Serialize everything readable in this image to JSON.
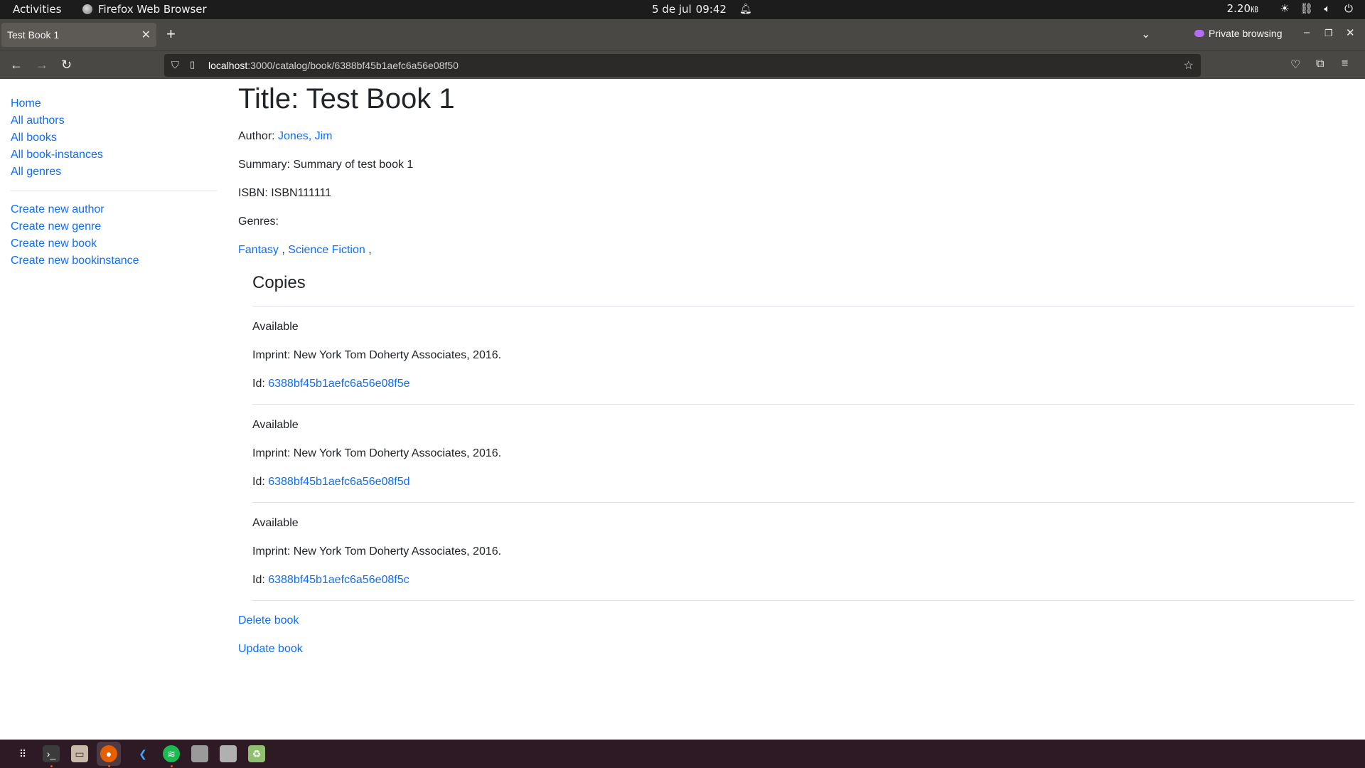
{
  "topbar": {
    "activities": "Activities",
    "app_name": "Firefox Web Browser",
    "date": "5 de jul",
    "time": "09:42",
    "speed": "2.20",
    "speed_unit": "㎅",
    "icons": [
      "bell-icon",
      "brightness-icon",
      "network-icon",
      "volume-icon",
      "power-icon"
    ]
  },
  "browser": {
    "tab_title": "Test Book 1",
    "tab_close": "✕",
    "new_tab": "+",
    "private_label": "Private browsing",
    "url_host": "localhost",
    "url_path": ":3000/catalog/book/6388bf45b1aefc6a56e08f50"
  },
  "sidebar": {
    "nav": [
      "Home",
      "All authors",
      "All books",
      "All book-instances",
      "All genres"
    ],
    "create": [
      "Create new author",
      "Create new genre",
      "Create new book",
      "Create new bookinstance"
    ]
  },
  "book": {
    "title": "Title: Test Book 1",
    "author_label": "Author: ",
    "author_name": "Jones, Jim",
    "summary": "Summary: Summary of test book 1",
    "isbn": "ISBN: ISBN111111",
    "genres_label": "Genres:",
    "genres": [
      "Fantasy",
      "Science Fiction"
    ],
    "genre_sep": " , ",
    "genre_tail": " ,"
  },
  "copies": {
    "heading": "Copies",
    "id_label": "Id: ",
    "items": [
      {
        "status": "Available",
        "imprint": "Imprint: New York Tom Doherty Associates, 2016.",
        "id": "6388bf45b1aefc6a56e08f5e"
      },
      {
        "status": "Available",
        "imprint": "Imprint: New York Tom Doherty Associates, 2016.",
        "id": "6388bf45b1aefc6a56e08f5d"
      },
      {
        "status": "Available",
        "imprint": "Imprint: New York Tom Doherty Associates, 2016.",
        "id": "6388bf45b1aefc6a56e08f5c"
      }
    ]
  },
  "actions": {
    "delete": "Delete book",
    "update": "Update book"
  },
  "colors": {
    "link": "#0d6efd",
    "status_available": "#212529"
  }
}
